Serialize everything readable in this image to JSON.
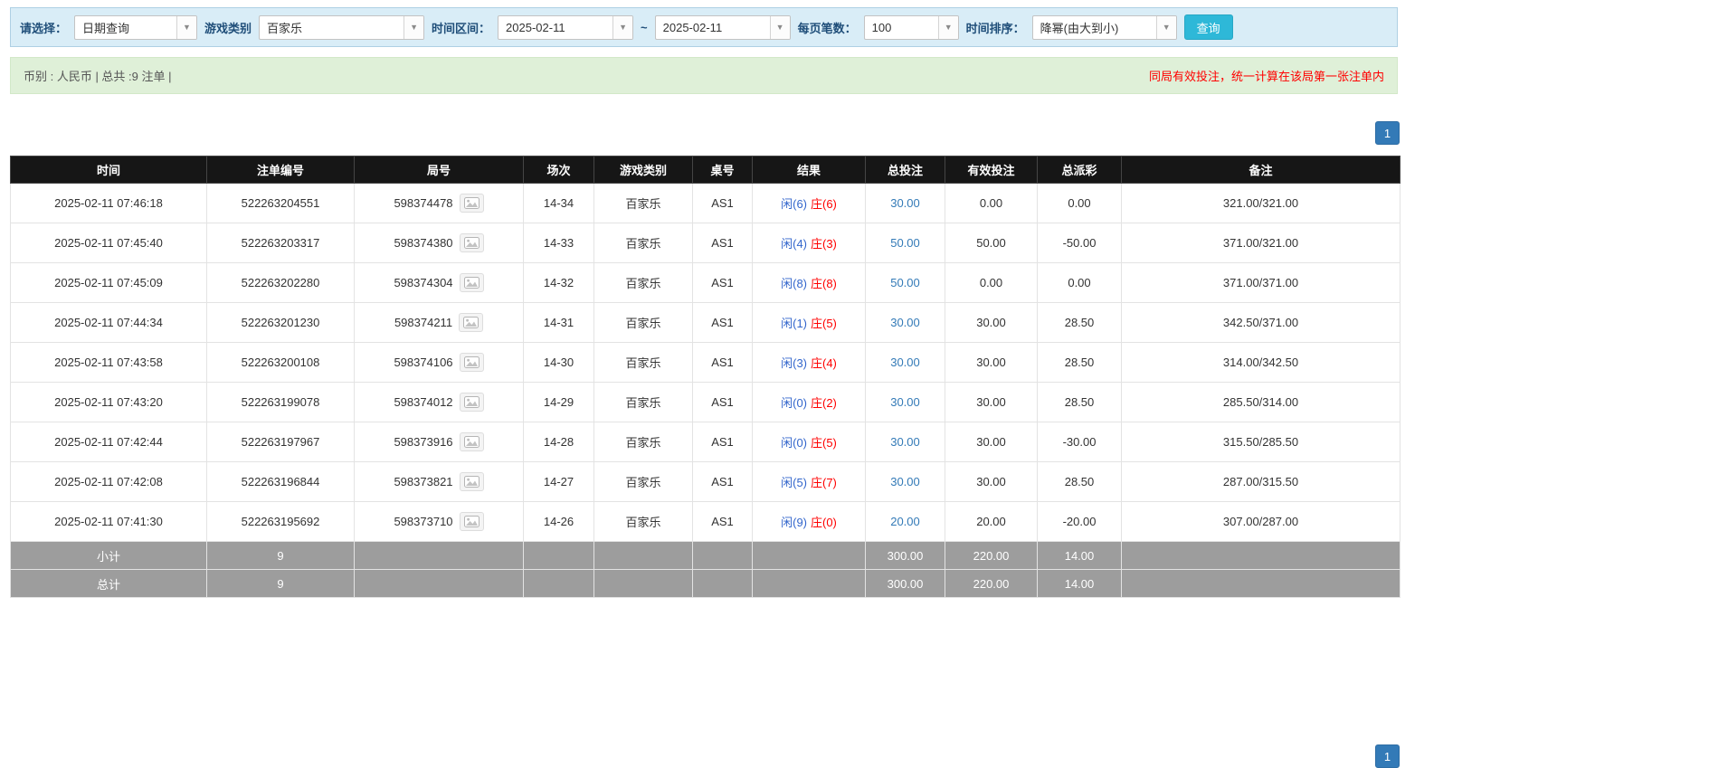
{
  "filters": {
    "select_label": "请选择：",
    "select_value": "日期查询",
    "game_type_label": "游戏类别",
    "game_type_value": "百家乐",
    "time_range_label": "时间区间：",
    "date_from": "2025-02-11",
    "range_separator": "~",
    "date_to": "2025-02-11",
    "page_size_label": "每页笔数：",
    "page_size_value": "100",
    "sort_label": "时间排序：",
    "sort_value": "降幂(由大到小)",
    "query_button_label": "查询"
  },
  "summary": {
    "currency_info": "币别 : 人民币 | 总共 :9 注单 |",
    "notice": "同局有效投注，统一计算在该局第一张注单内"
  },
  "pagination": {
    "page": "1"
  },
  "table": {
    "headers": [
      "时间",
      "注单编号",
      "局号",
      "场次",
      "游戏类别",
      "桌号",
      "结果",
      "总投注",
      "有效投注",
      "总派彩",
      "备注"
    ],
    "rows": [
      {
        "time": "2025-02-11 07:46:18",
        "bet_id": "522263204551",
        "round_id": "598374478",
        "session": "14-34",
        "game": "百家乐",
        "table_no": "AS1",
        "player": "闲(6)",
        "banker": "庄(6)",
        "total_bet": "30.00",
        "valid_bet": "0.00",
        "payout": "0.00",
        "remark": "321.00/321.00"
      },
      {
        "time": "2025-02-11 07:45:40",
        "bet_id": "522263203317",
        "round_id": "598374380",
        "session": "14-33",
        "game": "百家乐",
        "table_no": "AS1",
        "player": "闲(4)",
        "banker": "庄(3)",
        "total_bet": "50.00",
        "valid_bet": "50.00",
        "payout": "-50.00",
        "remark": "371.00/321.00"
      },
      {
        "time": "2025-02-11 07:45:09",
        "bet_id": "522263202280",
        "round_id": "598374304",
        "session": "14-32",
        "game": "百家乐",
        "table_no": "AS1",
        "player": "闲(8)",
        "banker": "庄(8)",
        "total_bet": "50.00",
        "valid_bet": "0.00",
        "payout": "0.00",
        "remark": "371.00/371.00"
      },
      {
        "time": "2025-02-11 07:44:34",
        "bet_id": "522263201230",
        "round_id": "598374211",
        "session": "14-31",
        "game": "百家乐",
        "table_no": "AS1",
        "player": "闲(1)",
        "banker": "庄(5)",
        "total_bet": "30.00",
        "valid_bet": "30.00",
        "payout": "28.50",
        "remark": "342.50/371.00"
      },
      {
        "time": "2025-02-11 07:43:58",
        "bet_id": "522263200108",
        "round_id": "598374106",
        "session": "14-30",
        "game": "百家乐",
        "table_no": "AS1",
        "player": "闲(3)",
        "banker": "庄(4)",
        "total_bet": "30.00",
        "valid_bet": "30.00",
        "payout": "28.50",
        "remark": "314.00/342.50"
      },
      {
        "time": "2025-02-11 07:43:20",
        "bet_id": "522263199078",
        "round_id": "598374012",
        "session": "14-29",
        "game": "百家乐",
        "table_no": "AS1",
        "player": "闲(0)",
        "banker": "庄(2)",
        "total_bet": "30.00",
        "valid_bet": "30.00",
        "payout": "28.50",
        "remark": "285.50/314.00"
      },
      {
        "time": "2025-02-11 07:42:44",
        "bet_id": "522263197967",
        "round_id": "598373916",
        "session": "14-28",
        "game": "百家乐",
        "table_no": "AS1",
        "player": "闲(0)",
        "banker": "庄(5)",
        "total_bet": "30.00",
        "valid_bet": "30.00",
        "payout": "-30.00",
        "remark": "315.50/285.50"
      },
      {
        "time": "2025-02-11 07:42:08",
        "bet_id": "522263196844",
        "round_id": "598373821",
        "session": "14-27",
        "game": "百家乐",
        "table_no": "AS1",
        "player": "闲(5)",
        "banker": "庄(7)",
        "total_bet": "30.00",
        "valid_bet": "30.00",
        "payout": "28.50",
        "remark": "287.00/315.50"
      },
      {
        "time": "2025-02-11 07:41:30",
        "bet_id": "522263195692",
        "round_id": "598373710",
        "session": "14-26",
        "game": "百家乐",
        "table_no": "AS1",
        "player": "闲(9)",
        "banker": "庄(0)",
        "total_bet": "20.00",
        "valid_bet": "20.00",
        "payout": "-20.00",
        "remark": "307.00/287.00"
      }
    ],
    "subtotal": {
      "label": "小计",
      "count": "9",
      "total_bet": "300.00",
      "valid_bet": "220.00",
      "payout": "14.00"
    },
    "total": {
      "label": "总计",
      "count": "9",
      "total_bet": "300.00",
      "valid_bet": "220.00",
      "payout": "14.00"
    }
  },
  "colors": {
    "accent_query": "#2eb8d8",
    "filter_bg": "#d9edf7",
    "summary_bg": "#dff0d8",
    "header_bg": "#161616",
    "footer_bg": "#9d9d9d",
    "pagination_blue": "#337ab7",
    "link_blue": "#337ab7",
    "player_blue": "#3366cc",
    "banker_red": "#ff0000",
    "negative_red": "#ff0000"
  }
}
